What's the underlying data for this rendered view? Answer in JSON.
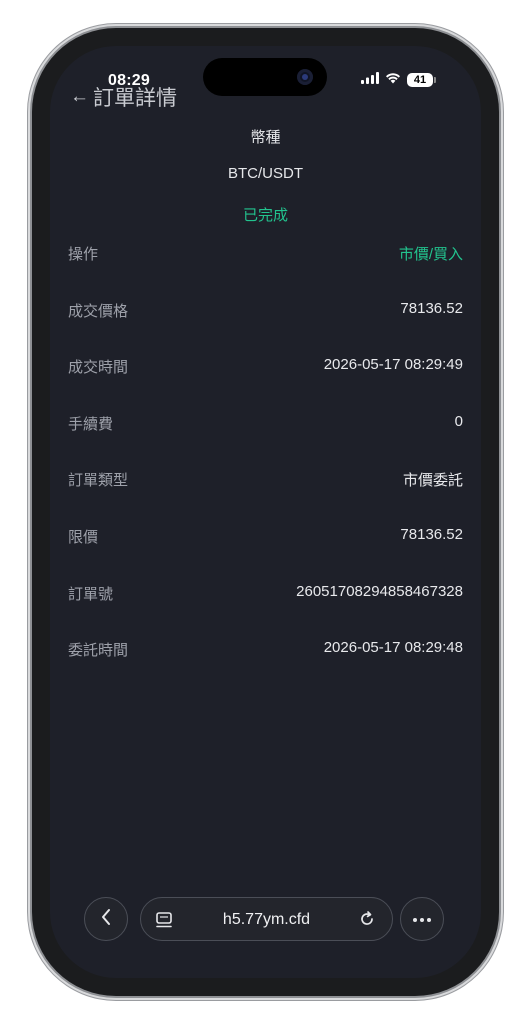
{
  "status_bar": {
    "time": "08:29",
    "battery": "41",
    "signal_icon": "signal-bars-icon",
    "wifi_icon": "wifi-icon"
  },
  "header": {
    "back_icon": "left-arrow-icon",
    "title": "訂單詳情"
  },
  "summary": {
    "coin_label": "幣種",
    "coin_value": "BTC/USDT",
    "status": "已完成"
  },
  "details": [
    {
      "label": "操作",
      "value": "市價/買入"
    },
    {
      "label": "成交價格",
      "value": "78136.52"
    },
    {
      "label": "成交時間",
      "value": "2026-05-17 08:29:49"
    },
    {
      "label": "手續費",
      "value": "0"
    },
    {
      "label": "訂單類型",
      "value": "市價委託"
    },
    {
      "label": "限價",
      "value": "78136.52"
    },
    {
      "label": "訂單號",
      "value": "2605170829485846732​8"
    },
    {
      "label": "委託時間",
      "value": "2026-05-17 08:29:48"
    }
  ],
  "browser_toolbar": {
    "back_icon": "chevron-left-icon",
    "tabs_icon": "tabs-icon",
    "url": "h5.77ym.cfd",
    "reload_icon": "reload-icon",
    "more_icon": "more-dots-icon"
  },
  "colors": {
    "background": "#1e2029",
    "accent_green": "#22c38e",
    "label_gray": "#9ea1aa"
  }
}
